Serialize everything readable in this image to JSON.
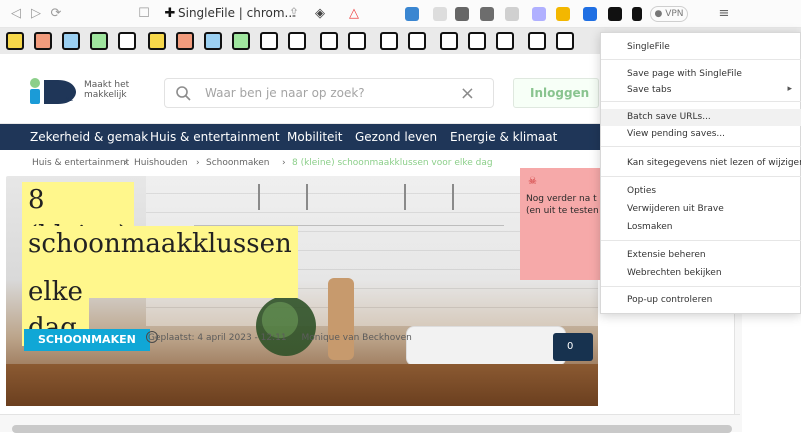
{
  "browser": {
    "tab_title": "SingleFile | chrom...",
    "vpn_label": "VPN"
  },
  "site": {
    "logo_text_line1": "Maakt het",
    "logo_text_line2": "makkelijk",
    "search_placeholder": "Waar ben je naar op zoek?",
    "login_label": "Inloggen"
  },
  "nav": {
    "items": [
      "Zekerheid & gemak",
      "Huis & entertainment",
      "Mobiliteit",
      "Gezond leven",
      "Energie & klimaat"
    ]
  },
  "breadcrumb": {
    "items": [
      "Huis & entertainment",
      "Huishouden",
      "Schoonmaken",
      "8 (kleine) schoonmaakklussen voor elke dag"
    ]
  },
  "article": {
    "title_lines": [
      "8 (kleine)",
      "schoonmaakklussen voor",
      "elke dag"
    ],
    "category": "SCHOONMAKEN",
    "meta": "Geplaatst: 4 april 2023 - 12:11",
    "author": "Monique van Beckhoven",
    "comments_count": "0"
  },
  "popup": {
    "line1": "Nog verder na t",
    "line2": "(en uit te testen"
  },
  "menu": {
    "items": [
      "SingleFile",
      "Save page with SingleFile",
      "Save tabs",
      "Batch save URLs...",
      "View pending saves...",
      "Kan sitegegevens niet lezen of wijzigen",
      "Opties",
      "Verwijderen uit Brave",
      "Losmaken",
      "Extensie beheren",
      "Webrechten bekijken",
      "Pop-up controleren"
    ]
  },
  "colors": {
    "nav_bg": "#1f3658",
    "accent_green": "#8ccf8a",
    "tag_blue": "#10a7d6",
    "highlight_yellow": "#fff78c",
    "popup_pink": "#f6a9a9"
  }
}
